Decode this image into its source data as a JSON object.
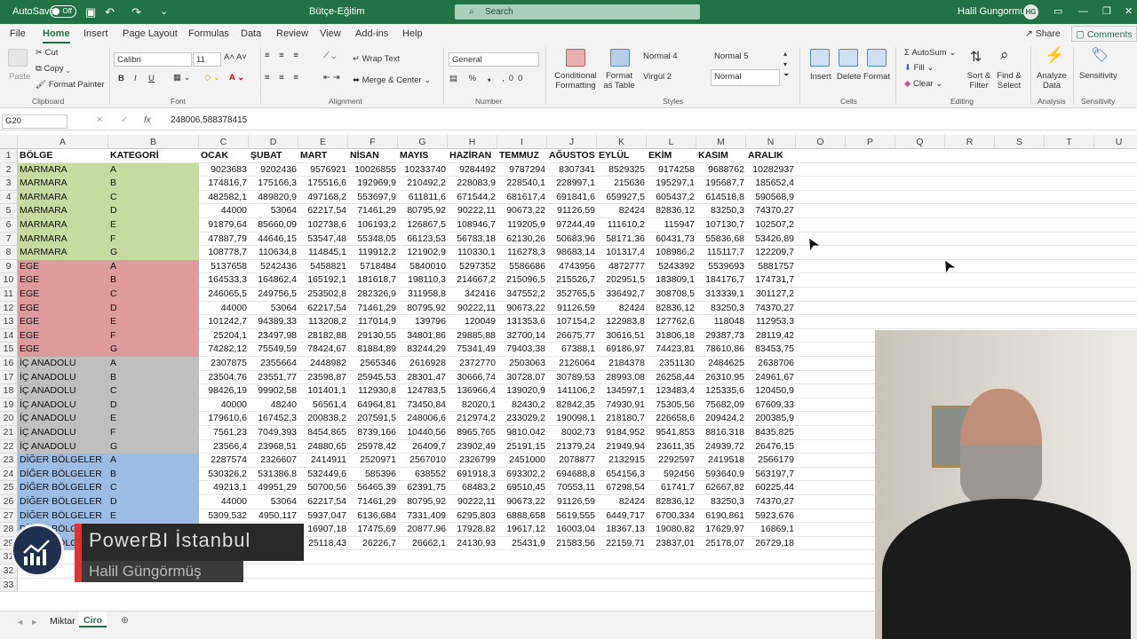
{
  "titlebar": {
    "autosave": "AutoSave",
    "autosave_state": "Off",
    "doc_title": "Bütçe-Eğitim",
    "search_placeholder": "Search",
    "user_name": "Halil Gungormus",
    "user_initials": "HG"
  },
  "menu": {
    "tabs": [
      "File",
      "Home",
      "Insert",
      "Page Layout",
      "Formulas",
      "Data",
      "Review",
      "View",
      "Add-ins",
      "Help"
    ],
    "share": "Share",
    "comments": "Comments"
  },
  "ribbon": {
    "clipboard": {
      "paste": "Paste",
      "cut": "Cut",
      "copy": "Copy",
      "format_painter": "Format Painter",
      "group": "Clipboard"
    },
    "font": {
      "name": "Calibri",
      "size": "11",
      "group": "Font"
    },
    "alignment": {
      "wrap": "Wrap Text",
      "merge": "Merge & Center",
      "group": "Alignment"
    },
    "number": {
      "format": "General",
      "group": "Number"
    },
    "styles": {
      "conditional": "Conditional Formatting",
      "format_table": "Format as Table",
      "normal4": "Normal 4",
      "normal5": "Normal 5",
      "virgul2": "Virgül 2",
      "normal": "Normal",
      "group": "Styles"
    },
    "cells": {
      "insert": "Insert",
      "delete": "Delete",
      "format": "Format",
      "group": "Cells"
    },
    "editing": {
      "autosum": "AutoSum",
      "fill": "Fill",
      "clear": "Clear",
      "sort": "Sort & Filter",
      "find": "Find & Select",
      "group": "Editing"
    },
    "analysis": {
      "analyze": "Analyze Data",
      "group": "Analysis"
    },
    "sensitivity": {
      "label": "Sensitivity",
      "group": "Sensitivity"
    }
  },
  "formula_bar": {
    "name_box": "G20",
    "fx": "fx",
    "content": "248006,588378415"
  },
  "columns": [
    "A",
    "B",
    "C",
    "D",
    "E",
    "F",
    "G",
    "H",
    "I",
    "J",
    "K",
    "L",
    "M",
    "N",
    "O",
    "P",
    "Q",
    "R",
    "S",
    "T",
    "U"
  ],
  "header_row": [
    "BÖLGE",
    "KATEGORİ",
    "OCAK",
    "ŞUBAT",
    "MART",
    "NİSAN",
    "MAYIS",
    "HAZİRAN",
    "TEMMUZ",
    "AĞUSTOS",
    "EYLÜL",
    "EKİM",
    "KASIM",
    "ARALIK"
  ],
  "rows": [
    [
      "MARMARA",
      "A",
      "9023683",
      "9202436",
      "9576921",
      "10026855",
      "10233740",
      "9284492",
      "9787294",
      "8307341",
      "8529325",
      "9174258",
      "9688762",
      "10282937"
    ],
    [
      "MARMARA",
      "B",
      "174816,7",
      "175166,3",
      "175516,6",
      "192969,9",
      "210492,2",
      "228083,9",
      "228540,1",
      "228997,1",
      "215636",
      "195297,1",
      "195687,7",
      "185652,4"
    ],
    [
      "MARMARA",
      "C",
      "482582,1",
      "489820,9",
      "497168,2",
      "553697,9",
      "611811,6",
      "671544,2",
      "681617,4",
      "691841,6",
      "659927,5",
      "605437,2",
      "614518,8",
      "590568,9"
    ],
    [
      "MARMARA",
      "D",
      "44000",
      "53064",
      "62217,54",
      "71461,29",
      "80795,92",
      "90222,11",
      "90673,22",
      "91126,59",
      "82424",
      "82836,12",
      "83250,3",
      "74370,27"
    ],
    [
      "MARMARA",
      "E",
      "91879,64",
      "85660,09",
      "102738,6",
      "106193,2",
      "126867,5",
      "108946,7",
      "119205,9",
      "97244,49",
      "111610,2",
      "115947",
      "107130,7",
      "102507,2"
    ],
    [
      "MARMARA",
      "F",
      "47887,79",
      "44646,15",
      "53547,48",
      "55348,05",
      "66123,53",
      "56783,18",
      "62130,26",
      "50683,96",
      "58171,36",
      "60431,73",
      "55836,68",
      "53426,89"
    ],
    [
      "MARMARA",
      "G",
      "108778,7",
      "110634,8",
      "114845,1",
      "119912,2",
      "121902,9",
      "110330,1",
      "116278,3",
      "98683,14",
      "101317,4",
      "108986,2",
      "115117,7",
      "122209,7"
    ],
    [
      "EGE",
      "A",
      "5137658",
      "5242436",
      "5458821",
      "5718484",
      "5840010",
      "5297352",
      "5586686",
      "4743956",
      "4872777",
      "5243392",
      "5539693",
      "5881757"
    ],
    [
      "EGE",
      "B",
      "164533,3",
      "164862,4",
      "165192,1",
      "181618,7",
      "198110,3",
      "214667,2",
      "215096,5",
      "215526,7",
      "202951,5",
      "183809,1",
      "184176,7",
      "174731,7"
    ],
    [
      "EGE",
      "C",
      "246065,5",
      "249756,5",
      "253502,8",
      "282326,9",
      "311958,8",
      "342416",
      "347552,2",
      "352765,5",
      "336492,7",
      "308708,5",
      "313339,1",
      "301127,2"
    ],
    [
      "EGE",
      "D",
      "44000",
      "53064",
      "62217,54",
      "71461,29",
      "80795,92",
      "90222,11",
      "90673,22",
      "91126,59",
      "82424",
      "82836,12",
      "83250,3",
      "74370,27"
    ],
    [
      "EGE",
      "E",
      "101242,7",
      "94389,33",
      "113208,2",
      "117014,9",
      "139796",
      "120049",
      "131353,6",
      "107154,2",
      "122983,8",
      "127762,6",
      "118048",
      "112953,3"
    ],
    [
      "EGE",
      "F",
      "25204,1",
      "23497,98",
      "28182,88",
      "29130,55",
      "34801,86",
      "29885,88",
      "32700,14",
      "26675,77",
      "30616,51",
      "31806,18",
      "29387,73",
      "28119,42"
    ],
    [
      "EGE",
      "G",
      "74282,12",
      "75549,59",
      "78424,67",
      "81884,89",
      "83244,29",
      "75341,49",
      "79403,38",
      "67388,1",
      "69186,97",
      "74423,81",
      "78610,86",
      "83453,75"
    ],
    [
      "İÇ ANADOLU",
      "A",
      "2307875",
      "2355664",
      "2448982",
      "2565346",
      "2616928",
      "2372770",
      "2503063",
      "2126064",
      "2184378",
      "2351130",
      "2484625",
      "2638706"
    ],
    [
      "İÇ ANADOLU",
      "B",
      "23504,76",
      "23551,77",
      "23598,87",
      "25945,53",
      "28301,47",
      "30666,74",
      "30728,07",
      "30789,53",
      "28993,08",
      "26258,44",
      "26310,95",
      "24961,67"
    ],
    [
      "İÇ ANADOLU",
      "C",
      "98426,19",
      "99902,58",
      "101401,1",
      "112930,8",
      "124783,5",
      "136966,4",
      "139020,9",
      "141106,2",
      "134597,1",
      "123483,4",
      "125335,6",
      "120450,9"
    ],
    [
      "İÇ ANADOLU",
      "D",
      "40000",
      "48240",
      "56561,4",
      "64964,81",
      "73450,84",
      "82020,1",
      "82430,2",
      "82842,35",
      "74930,91",
      "75305,56",
      "75682,09",
      "67609,33"
    ],
    [
      "İÇ ANADOLU",
      "E",
      "179610,6",
      "167452,3",
      "200838,2",
      "207591,5",
      "248006,6",
      "212974,2",
      "233029,2",
      "190098,1",
      "218180,7",
      "226658,6",
      "209424,2",
      "200385,9"
    ],
    [
      "İÇ ANADOLU",
      "F",
      "7561,23",
      "7049,393",
      "8454,865",
      "8739,166",
      "10440,56",
      "8965,765",
      "9810,042",
      "8002,73",
      "9184,952",
      "9541,853",
      "8816,318",
      "8435,825"
    ],
    [
      "İÇ ANADOLU",
      "G",
      "23566,4",
      "23968,51",
      "24880,65",
      "25978,42",
      "26409,7",
      "23902,49",
      "25191,15",
      "21379,24",
      "21949,94",
      "23611,35",
      "24939,72",
      "26476,15"
    ],
    [
      "DİĞER BÖLGELER",
      "A",
      "2287574",
      "2326607",
      "2414911",
      "2520971",
      "2567010",
      "2326799",
      "2451000",
      "2078877",
      "2132915",
      "2292597",
      "2419518",
      "2566179"
    ],
    [
      "DİĞER BÖLGELER",
      "B",
      "530326,2",
      "531386,8",
      "532449,6",
      "585396",
      "638552",
      "691918,3",
      "693302,2",
      "694688,8",
      "654156,3",
      "592456",
      "593640,9",
      "563197,7"
    ],
    [
      "DİĞER BÖLGELER",
      "C",
      "49213,1",
      "49951,29",
      "50700,56",
      "56465,39",
      "62391,75",
      "68483,2",
      "69510,45",
      "70553,11",
      "67298,54",
      "61741,7",
      "62667,82",
      "60225,44"
    ],
    [
      "DİĞER BÖLGELER",
      "D",
      "44000",
      "53064",
      "62217,54",
      "71461,29",
      "80795,92",
      "90222,11",
      "90673,22",
      "91126,59",
      "82424",
      "82836,12",
      "83250,3",
      "74370,27"
    ],
    [
      "DİĞER BÖLGELER",
      "E",
      "5309,532",
      "4950,117",
      "5937,047",
      "6136,684",
      "7331,409",
      "6295,803",
      "6888,658",
      "5619,555",
      "6449,717",
      "6700,334",
      "6190,861",
      "5923,676"
    ],
    [
      "DİĞER BÖLGELER",
      "F",
      "",
      "",
      "16907,18",
      "17475,69",
      "20877,96",
      "17928,82",
      "19617,12",
      "16003,04",
      "18367,13",
      "19080,82",
      "17629,97",
      "16869,1"
    ],
    [
      "DİĞER BÖLGELER",
      "G",
      "",
      "",
      "25118,43",
      "26226,7",
      "26662,1",
      "24130,93",
      "25431,9",
      "21583,56",
      "22159,71",
      "23837,01",
      "25178,07",
      "26729,18"
    ]
  ],
  "row_numbers": [
    "1",
    "2",
    "3",
    "4",
    "5",
    "6",
    "7",
    "8",
    "9",
    "10",
    "11",
    "12",
    "13",
    "14",
    "15",
    "16",
    "17",
    "18",
    "19",
    "20",
    "21",
    "22",
    "23",
    "24",
    "25",
    "26",
    "27",
    "28",
    "29",
    "31",
    "32",
    "33"
  ],
  "region_colors": {
    "MARMARA": "#c6dba0",
    "EGE": "#dd9b9b",
    "İÇ ANADOLU": "#bfbfbf",
    "DİĞER BÖLGELER": "#9cbde3"
  },
  "sheets": {
    "tabs": [
      "Miktar",
      "Ciro"
    ],
    "active": "Ciro"
  },
  "overlay": {
    "title": "PowerBI İstanbul",
    "name": "Halil Güngörmüş"
  }
}
